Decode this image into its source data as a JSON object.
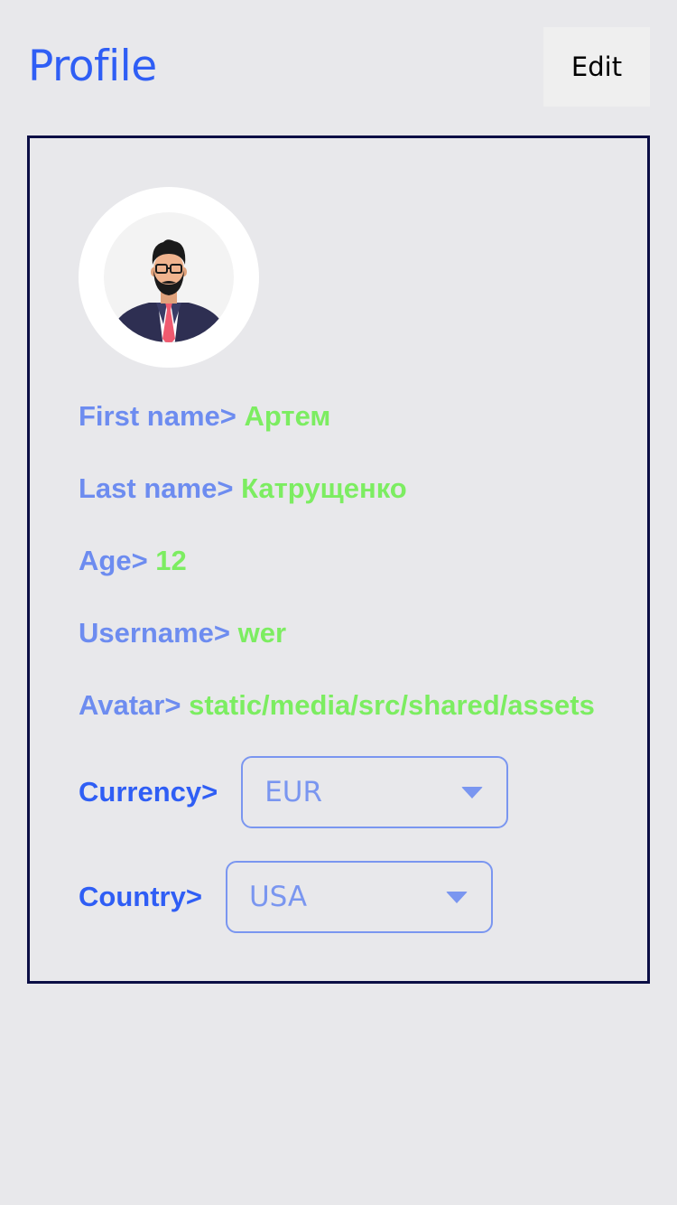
{
  "header": {
    "title": "Profile",
    "edit_label": "Edit"
  },
  "profile": {
    "avatar_icon": "person-avatar-icon",
    "fields": [
      {
        "label": "First name>",
        "value": "Артем"
      },
      {
        "label": "Last name>",
        "value": "Катрущенко"
      },
      {
        "label": "Age>",
        "value": "12"
      },
      {
        "label": "Username>",
        "value": "wer"
      },
      {
        "label": "Avatar>",
        "value": "static/media/src/shared/assets"
      }
    ],
    "currency": {
      "label": "Currency>",
      "value": "EUR"
    },
    "country": {
      "label": "Country>",
      "value": "USA"
    }
  },
  "colors": {
    "accent": "#2f5ef5",
    "label": "#6d8cf0",
    "value": "#7ced61",
    "card_border": "#0b0e45",
    "background": "#e8e8eb"
  }
}
